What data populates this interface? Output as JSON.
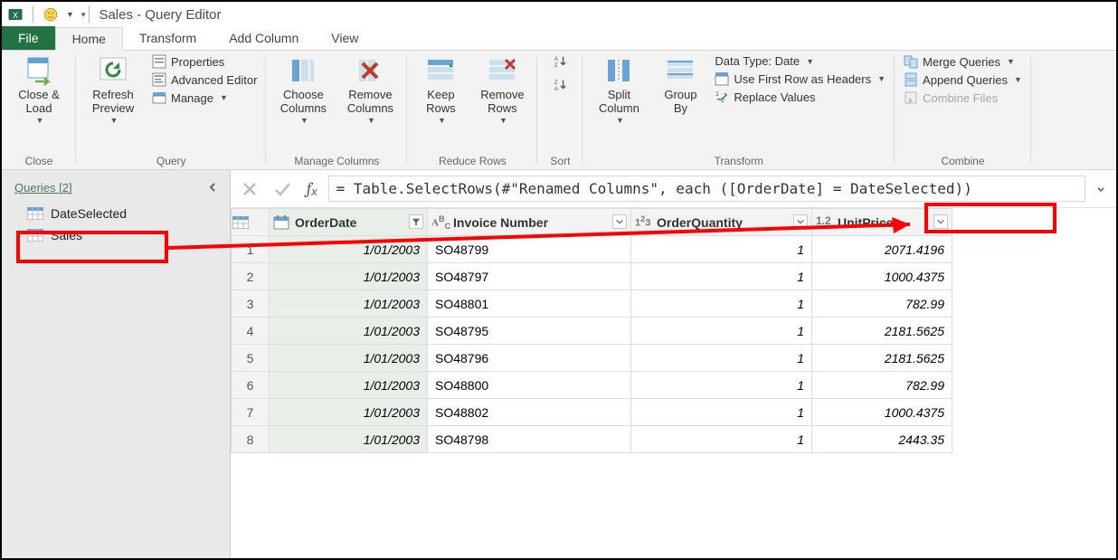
{
  "title": "Sales - Query Editor",
  "tabs": {
    "file": "File",
    "home": "Home",
    "transform": "Transform",
    "addcol": "Add Column",
    "view": "View"
  },
  "ribbon": {
    "close": {
      "close_load": "Close &\nLoad",
      "group": "Close"
    },
    "query": {
      "refresh": "Refresh\nPreview",
      "properties": "Properties",
      "advanced": "Advanced Editor",
      "manage": "Manage",
      "group": "Query"
    },
    "managecols": {
      "choose": "Choose\nColumns",
      "remove": "Remove\nColumns",
      "group": "Manage Columns"
    },
    "reducerows": {
      "keep": "Keep\nRows",
      "remove": "Remove\nRows",
      "group": "Reduce Rows"
    },
    "sort": {
      "group": "Sort"
    },
    "split_group": {
      "split": "Split\nColumn",
      "groupby": "Group\nBy"
    },
    "transform": {
      "datatype": "Data Type: Date",
      "firstrow": "Use First Row as Headers",
      "replace": "Replace Values",
      "group": "Transform"
    },
    "combine": {
      "merge": "Merge Queries",
      "append": "Append Queries",
      "combinefiles": "Combine Files",
      "group": "Combine"
    }
  },
  "sidebar": {
    "header": "Queries [2]",
    "items": [
      "DateSelected",
      "Sales"
    ]
  },
  "formula": "= Table.SelectRows(#\"Renamed Columns\", each ([OrderDate] = DateSelected))",
  "columns": [
    "OrderDate",
    "Invoice Number",
    "OrderQuantity",
    "UnitPrice"
  ],
  "rows": [
    {
      "n": "1",
      "date": "1/01/2003",
      "inv": "SO48799",
      "qty": "1",
      "price": "2071.4196"
    },
    {
      "n": "2",
      "date": "1/01/2003",
      "inv": "SO48797",
      "qty": "1",
      "price": "1000.4375"
    },
    {
      "n": "3",
      "date": "1/01/2003",
      "inv": "SO48801",
      "qty": "1",
      "price": "782.99"
    },
    {
      "n": "4",
      "date": "1/01/2003",
      "inv": "SO48795",
      "qty": "1",
      "price": "2181.5625"
    },
    {
      "n": "5",
      "date": "1/01/2003",
      "inv": "SO48796",
      "qty": "1",
      "price": "2181.5625"
    },
    {
      "n": "6",
      "date": "1/01/2003",
      "inv": "SO48800",
      "qty": "1",
      "price": "782.99"
    },
    {
      "n": "7",
      "date": "1/01/2003",
      "inv": "SO48802",
      "qty": "1",
      "price": "1000.4375"
    },
    {
      "n": "8",
      "date": "1/01/2003",
      "inv": "SO48798",
      "qty": "1",
      "price": "2443.35"
    }
  ]
}
